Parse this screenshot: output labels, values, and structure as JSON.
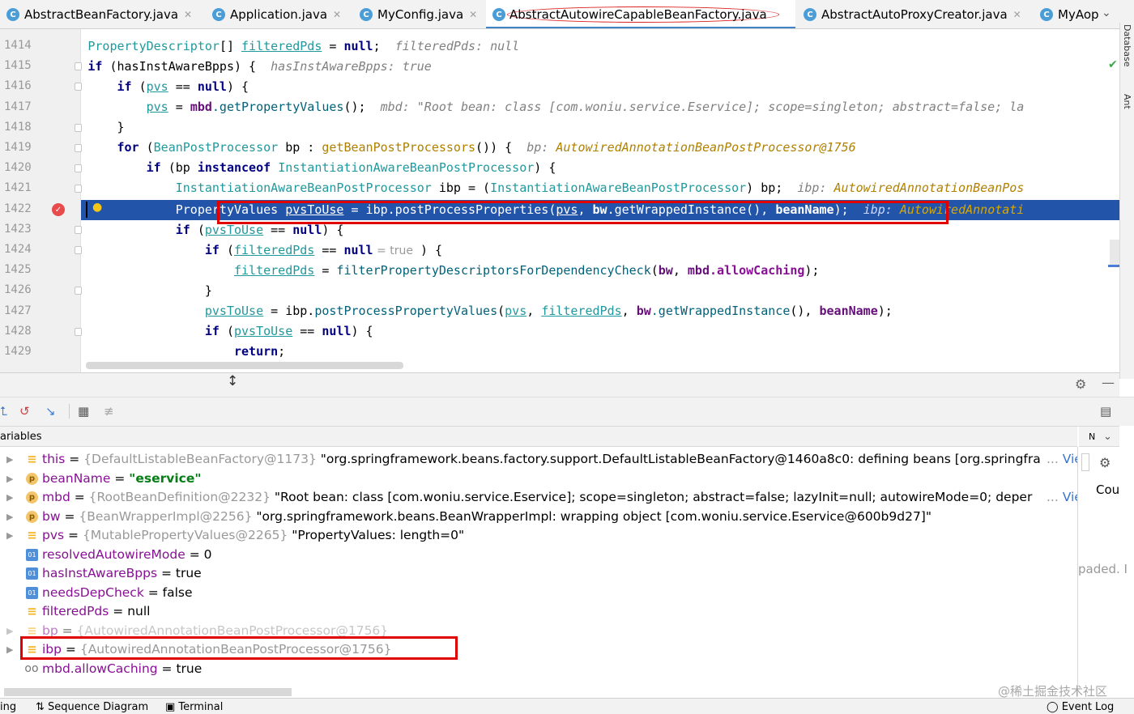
{
  "tabs": [
    {
      "label": "AbstractBeanFactory.java",
      "active": false
    },
    {
      "label": "Application.java",
      "active": false
    },
    {
      "label": "MyConfig.java",
      "active": false
    },
    {
      "label": "AbstractAutowireCapableBeanFactory.java",
      "active": true
    },
    {
      "label": "AbstractAutoProxyCreator.java",
      "active": false
    },
    {
      "label": "MyAop",
      "active": false
    }
  ],
  "right_strip": {
    "database_label": "Database",
    "ant_label": "Ant"
  },
  "editor": {
    "line_numbers": [
      "1414",
      "1415",
      "1416",
      "1417",
      "1418",
      "1419",
      "1420",
      "1421",
      "1422",
      "1423",
      "1424",
      "1425",
      "1426",
      "1427",
      "1428",
      "1429"
    ],
    "current_line": "1422",
    "lines": [
      {
        "indent": "            ",
        "type": "PropertyDescriptor",
        "brackets": "[] ",
        "var": "filteredPds",
        "rest": " = ",
        "kw": "null",
        "end": ";",
        "hint": "filteredPds: null"
      },
      {
        "indent": "            ",
        "kw": "if",
        "rest": " (hasInstAwareBpps) {",
        "hint": "hasInstAwareBpps: true"
      },
      {
        "indent": "                ",
        "kw": "if",
        "open": " (",
        "var": "pvs",
        "rest": " == ",
        "kw2": "null",
        "end": ") {"
      },
      {
        "indent": "                    ",
        "var": "pvs",
        "rest": " = ",
        "obj": "mbd",
        "method": ".getPropertyValues",
        "end": "();",
        "hint": "mbd: \"Root bean: class [com.woniu.service.Eservice]; scope=singleton; abstract=false; la"
      },
      {
        "indent": "                ",
        "rest": "}"
      },
      {
        "indent": "                ",
        "kw": "for",
        "open": " (",
        "type": "BeanPostProcessor",
        "rest": " bp : ",
        "method": "getBeanPostProcessors",
        "end": "()) {",
        "hint_label": "bp: ",
        "hint": "AutowiredAnnotationBeanPostProcessor@1756"
      },
      {
        "indent": "                    ",
        "kw": "if",
        "rest": " (bp ",
        "kw2": "instanceof",
        "type": "InstantiationAwareBeanPostProcessor",
        "end": ") {"
      },
      {
        "indent": "                        ",
        "type": "InstantiationAwareBeanPostProcessor",
        "rest": " ibp = (",
        "type2": "InstantiationAwareBeanPostProcessor",
        "end": ") bp;",
        "hint_label": "ibp: ",
        "hint": "AutowiredAnnotationBeanPos"
      },
      {
        "indent": "                        ",
        "text": "PropertyValues ",
        "var": "pvsToUse",
        "rest": " = ibp.postProcessProperties(",
        "var2": "pvs",
        "rest2": ", ",
        "bold": "bw",
        "rest3": ".getWrappedInstance(), ",
        "bold2": "beanName",
        "end": ");",
        "hint_label": "ibp: ",
        "hint": "AutowiredAnnotati"
      },
      {
        "indent": "                        ",
        "kw": "if",
        "open": " (",
        "var": "pvsToUse",
        "rest": " == ",
        "kw2": "null",
        "end": ") {"
      },
      {
        "indent": "                            ",
        "kw": "if",
        "open": " (",
        "var": "filteredPds",
        "rest": " == ",
        "kw2": "null",
        "inline_hint": " = true",
        "end": " ) {"
      },
      {
        "indent": "                                ",
        "var": "filteredPds",
        "rest": " = ",
        "method": "filterPropertyDescriptorsForDependencyCheck",
        "open2": "(",
        "obj": "bw",
        "rest2": ", ",
        "obj2": "mbd",
        "method2": ".allowCaching",
        "end": ");"
      },
      {
        "indent": "                            ",
        "rest": "}"
      },
      {
        "indent": "                            ",
        "var": "pvsToUse",
        "rest": " = ibp.",
        "method": "postProcessPropertyValues",
        "open2": "(",
        "var2": "pvs",
        "rest2": ", ",
        "var3": "filteredPds",
        "rest3": ", ",
        "obj": "bw",
        "method2": ".getWrappedInstance",
        "rest4": "(), ",
        "obj2": "beanName",
        "end": ");"
      },
      {
        "indent": "                            ",
        "kw": "if",
        "open": " (",
        "var": "pvsToUse",
        "rest": " == ",
        "kw2": "null",
        "end": ") {"
      },
      {
        "indent": "                                ",
        "kw": "return",
        "end": ";"
      }
    ]
  },
  "debug": {
    "toolbar_icons": [
      "step-out-icon",
      "drop-frame-icon",
      "force-step-icon",
      "evaluate-icon",
      "trace-icon"
    ],
    "variables_title": "ariables",
    "variables": [
      {
        "icon": "obj",
        "name": "this",
        "ref": "{DefaultListableBeanFactory@1173}",
        "value": "\"org.springframework.beans.factory.support.DefaultListableBeanFactory@1460a8c0: defining beans [org.springfra",
        "more": "... ",
        "view": "View",
        "expandable": true
      },
      {
        "icon": "prm",
        "name": "beanName",
        "ref": "",
        "value": "\"eservice\"",
        "bold": true,
        "expandable": true
      },
      {
        "icon": "prm",
        "name": "mbd",
        "ref": "{RootBeanDefinition@2232}",
        "value": "\"Root bean: class [com.woniu.service.Eservice]; scope=singleton; abstract=false; lazyInit=null; autowireMode=0; deper",
        "more": "... ",
        "view": "View",
        "expandable": true
      },
      {
        "icon": "prm",
        "name": "bw",
        "ref": "{BeanWrapperImpl@2256}",
        "value": "\"org.springframework.beans.BeanWrapperImpl: wrapping object [com.woniu.service.Eservice@600b9d27]\"",
        "expandable": true
      },
      {
        "icon": "obj",
        "name": "pvs",
        "ref": "{MutablePropertyValues@2265}",
        "value": "\"PropertyValues: length=0\"",
        "expandable": true
      },
      {
        "icon": "prim",
        "name": "resolvedAutowireMode",
        "ref": "",
        "value": "0",
        "expandable": false
      },
      {
        "icon": "prim",
        "name": "hasInstAwareBpps",
        "ref": "",
        "value": "true",
        "expandable": false
      },
      {
        "icon": "prim",
        "name": "needsDepCheck",
        "ref": "",
        "value": "false",
        "expandable": false
      },
      {
        "icon": "obj",
        "name": "filteredPds",
        "ref": "",
        "value": "null",
        "expandable": false
      },
      {
        "icon": "obj",
        "name": "bp",
        "ref": "{AutowiredAnnotationBeanPostProcessor@1756}",
        "value": "",
        "expandable": true
      },
      {
        "icon": "obj",
        "name": "ibp",
        "ref": "{AutowiredAnnotationBeanPostProcessor@1756}",
        "value": "",
        "expandable": true
      },
      {
        "icon": "watch",
        "name": "mbd.allowCaching",
        "ref": "",
        "value": "true",
        "expandable": false
      }
    ],
    "right_pane_text": {
      "cou": "Cou",
      "loaded": "paded. I",
      "header_letter": "N"
    }
  },
  "bottom_bar": {
    "left_fragment": "ing",
    "sequence_diagram": "Sequence Diagram",
    "terminal": "Terminal",
    "event_log": "Event Log"
  },
  "watermark": "@稀土掘金技术社区",
  "colors": {
    "selection": "#2255a9",
    "annotation_red": "#e00000",
    "keyword": "#000080",
    "field": "#871094",
    "link": "#3874d0"
  }
}
